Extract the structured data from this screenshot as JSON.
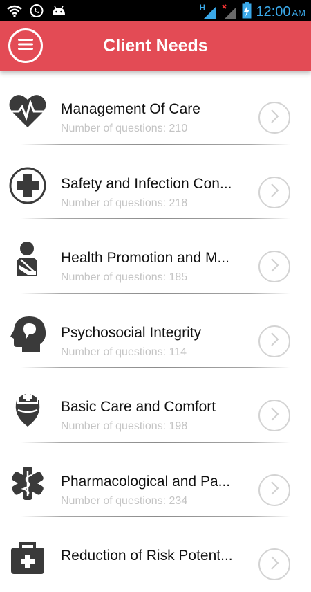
{
  "status_bar": {
    "time": "12:00",
    "ampm": "AM",
    "network_label": "H",
    "icons": [
      "wifi-icon",
      "whatsapp-icon",
      "android-icon",
      "signal-h-icon",
      "signal-x-icon",
      "battery-charging-icon"
    ]
  },
  "header": {
    "title": "Client Needs",
    "menu_icon": "hamburger-menu-icon",
    "color": "#e34b55"
  },
  "categories": [
    {
      "title": "Management Of Care",
      "subtitle": "Number of questions: 210",
      "icon": "heart-pulse-icon"
    },
    {
      "title": "Safety and Infection Con...",
      "subtitle": "Number of questions: 218",
      "icon": "medical-cross-icon"
    },
    {
      "title": "Health Promotion and M...",
      "subtitle": "Number of questions: 185",
      "icon": "person-sling-icon"
    },
    {
      "title": "Psychosocial Integrity",
      "subtitle": "Number of questions: 114",
      "icon": "head-mind-icon"
    },
    {
      "title": "Basic Care and Comfort",
      "subtitle": "Number of questions: 198",
      "icon": "nurse-cap-shield-icon"
    },
    {
      "title": "Pharmacological and Pa...",
      "subtitle": "Number of questions: 234",
      "icon": "pharmacy-caduceus-icon"
    },
    {
      "title": "Reduction of Risk Potent...",
      "subtitle": "",
      "icon": "medical-kit-icon"
    }
  ],
  "row_action_icon": "chevron-right-circle-icon"
}
